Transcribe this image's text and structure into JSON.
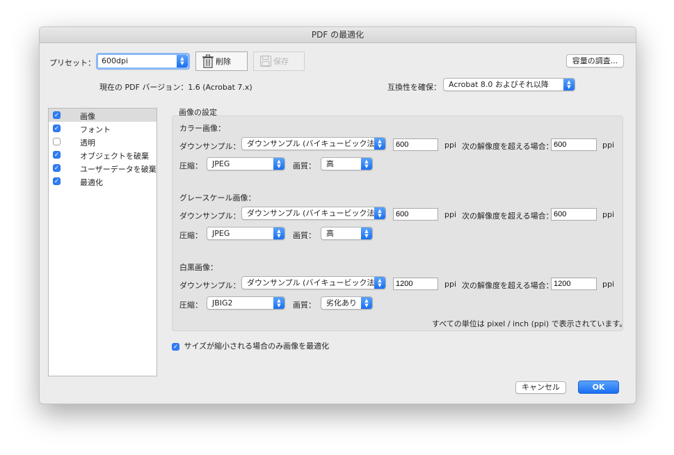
{
  "window": {
    "title": "PDF の最適化"
  },
  "toolbar": {
    "preset_label": "プリセット：",
    "preset_value": "600dpi",
    "delete_label": "削除",
    "save_label": "保存",
    "audit_label": "容量の調査..."
  },
  "info": {
    "current_version": "現在の PDF バージョン：1.6 (Acrobat 7.x)",
    "compat_label": "互換性を確保：",
    "compat_value": "Acrobat 8.0 およびそれ以降"
  },
  "sidebar": {
    "items": [
      {
        "label": "画像",
        "checked": true
      },
      {
        "label": "フォント",
        "checked": true
      },
      {
        "label": "透明",
        "checked": false
      },
      {
        "label": "オブジェクトを破棄",
        "checked": true
      },
      {
        "label": "ユーザーデータを破棄",
        "checked": true
      },
      {
        "label": "最適化",
        "checked": true
      }
    ]
  },
  "image_settings": {
    "heading": "画像の設定",
    "downsample_label": "ダウンサンプル：",
    "ppi_unit": "ppi",
    "above_label": "次の解像度を超える場合：",
    "compression_label": "圧縮：",
    "quality_label": "画質：",
    "sections": [
      {
        "title": "カラー画像：",
        "method": "ダウンサンプル (バイキュービック法)",
        "ppi": "600",
        "above_ppi": "600",
        "compression": "JPEG",
        "quality": "高"
      },
      {
        "title": "グレースケール画像：",
        "method": "ダウンサンプル (バイキュービック法)",
        "ppi": "600",
        "above_ppi": "600",
        "compression": "JPEG",
        "quality": "高"
      },
      {
        "title": "白黒画像：",
        "method": "ダウンサンプル (バイキュービック法)",
        "ppi": "1200",
        "above_ppi": "1200",
        "compression": "JBIG2",
        "quality": "劣化あり"
      }
    ],
    "units_note": "すべての単位は pixel / inch (ppi) で表示されています。",
    "only_if_smaller": "サイズが縮小される場合のみ画像を最適化"
  },
  "footer": {
    "cancel_label": "キャンセル",
    "ok_label": "OK"
  }
}
